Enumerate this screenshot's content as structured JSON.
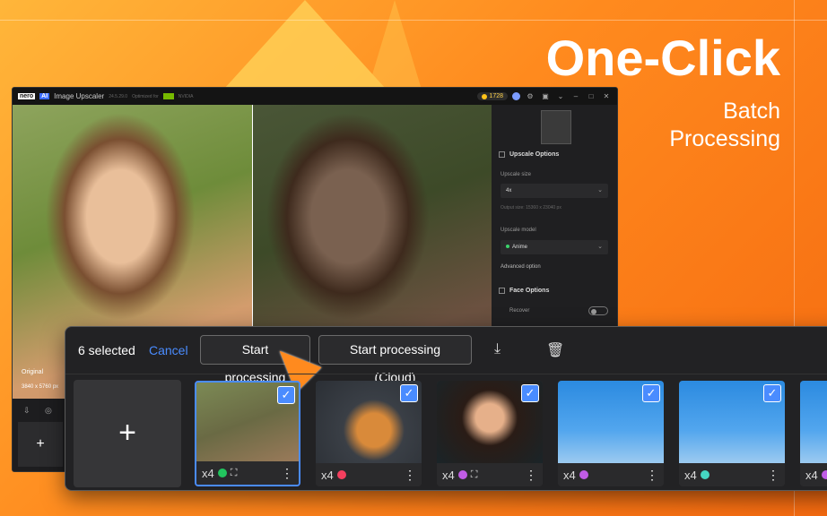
{
  "promo": {
    "headline": "One-Click",
    "sub1": "Batch",
    "sub2": "Processing"
  },
  "app": {
    "logo_nero": "nero",
    "logo_ai": "AI",
    "title": "Image Upscaler",
    "version": "24.5.29.0",
    "powered": "Optimized for",
    "nvidia": "NVIDIA",
    "credits": "1728"
  },
  "viewer": {
    "original_label": "Original",
    "dimensions": "3840 x 5760 px"
  },
  "panel": {
    "upscale_options": "Upscale Options",
    "upscale_size_label": "Upscale size",
    "upscale_size_value": "4x",
    "output_size": "Output size: 15360 x 23040 px",
    "model_label": "Upscale model",
    "model_value": "Anime",
    "advanced": "Advanced option",
    "face_options": "Face Options",
    "recover": "Recover"
  },
  "batch": {
    "selected": "6 selected",
    "cancel": "Cancel",
    "start": "Start processing",
    "start_cloud": "Start processing (Cloud)",
    "add": "+",
    "tiles": [
      {
        "scale": "x4",
        "dot": "#22c55e",
        "face": true,
        "checked": true
      },
      {
        "scale": "x4",
        "dot": "#f43f5e",
        "face": false,
        "checked": true
      },
      {
        "scale": "x4",
        "dot": "#c05ce6",
        "face": true,
        "checked": true
      },
      {
        "scale": "x4",
        "dot": "#c05ce6",
        "face": false,
        "checked": true
      },
      {
        "scale": "x4",
        "dot": "#45d6c2",
        "face": false,
        "checked": true
      },
      {
        "scale": "x4",
        "dot": "#c05ce6",
        "face": false,
        "checked": true
      }
    ]
  }
}
